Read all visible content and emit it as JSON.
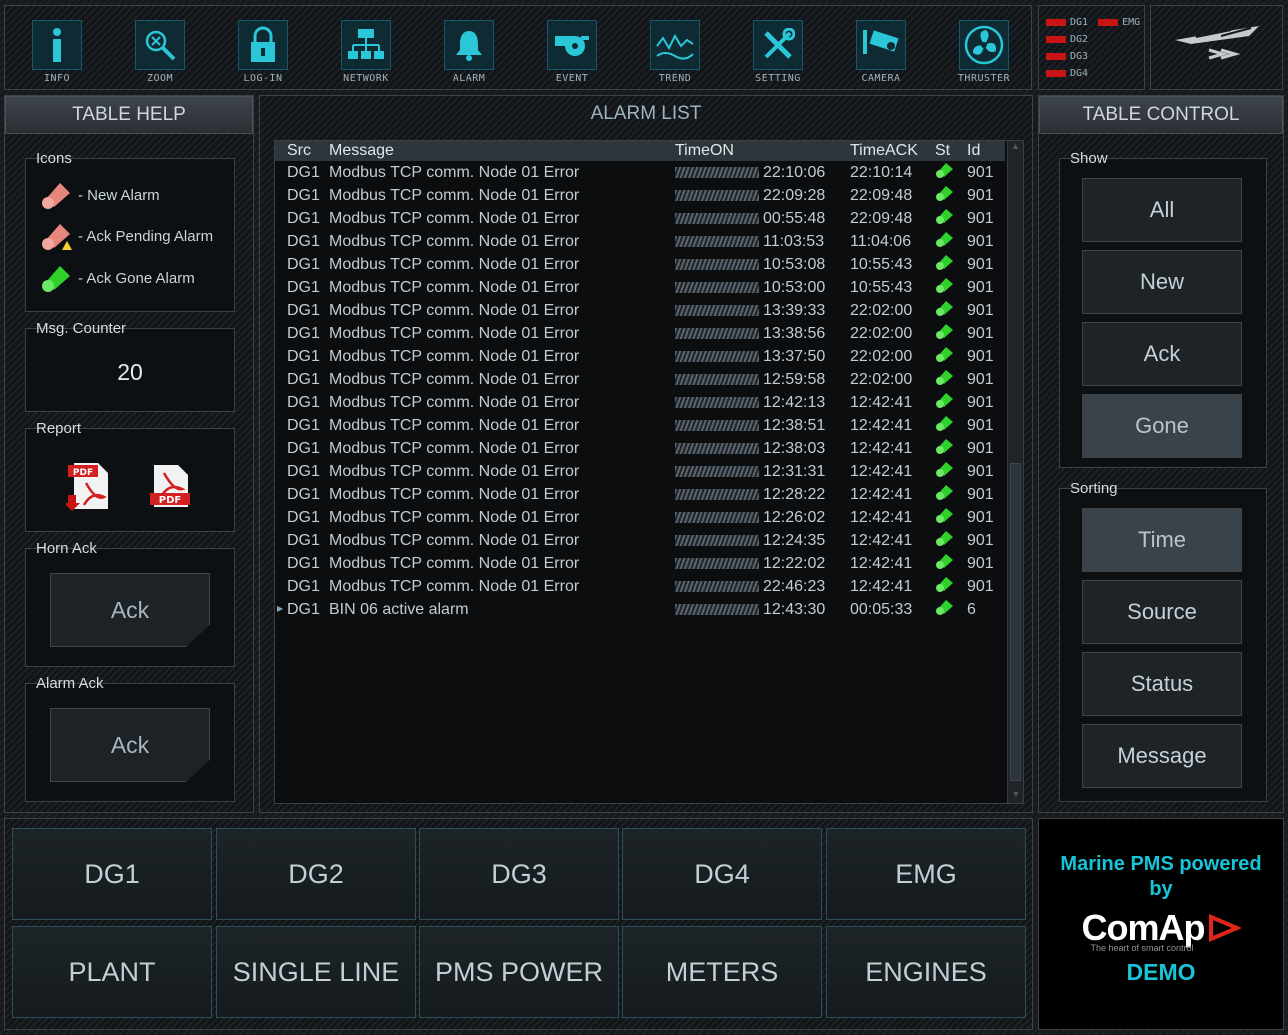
{
  "toolbar": [
    {
      "label": "INFO",
      "icon": "info-icon"
    },
    {
      "label": "ZOOM",
      "icon": "zoom-icon"
    },
    {
      "label": "LOG-IN",
      "icon": "lock-icon"
    },
    {
      "label": "NETWORK",
      "icon": "network-icon"
    },
    {
      "label": "ALARM",
      "icon": "bell-icon"
    },
    {
      "label": "EVENT",
      "icon": "whistle-icon"
    },
    {
      "label": "TREND",
      "icon": "trend-icon"
    },
    {
      "label": "SETTING",
      "icon": "tools-icon"
    },
    {
      "label": "CAMERA",
      "icon": "camera-icon"
    },
    {
      "label": "THRUSTER",
      "icon": "fan-icon"
    }
  ],
  "gen_status": {
    "a": "DG1",
    "b": "EMG",
    "c": "DG2",
    "d": "DG3",
    "e": "DG4"
  },
  "left": {
    "title": "TABLE HELP",
    "icons_title": "Icons",
    "new_alarm": "- New Alarm",
    "ack_pending": "- Ack Pending Alarm",
    "ack_gone": "- Ack Gone Alarm",
    "counter_title": "Msg. Counter",
    "counter_value": "20",
    "report_title": "Report",
    "horn_title": "Horn Ack",
    "horn_btn": "Ack",
    "alarm_title": "Alarm Ack",
    "alarm_btn": "Ack"
  },
  "center": {
    "title": "ALARM LIST",
    "columns": {
      "src": "Src",
      "msg": "Message",
      "on": "TimeON",
      "ack": "TimeACK",
      "st": "St",
      "id": "Id"
    },
    "rows": [
      {
        "src": "DG1",
        "msg": "Modbus TCP comm. Node 01  Error",
        "on": "22:10:06",
        "ack": "22:10:14",
        "id": "901"
      },
      {
        "src": "DG1",
        "msg": "Modbus TCP comm. Node 01  Error",
        "on": "22:09:28",
        "ack": "22:09:48",
        "id": "901"
      },
      {
        "src": "DG1",
        "msg": "Modbus TCP comm. Node 01  Error",
        "on": "00:55:48",
        "ack": "22:09:48",
        "id": "901"
      },
      {
        "src": "DG1",
        "msg": "Modbus TCP comm. Node 01  Error",
        "on": "11:03:53",
        "ack": "11:04:06",
        "id": "901"
      },
      {
        "src": "DG1",
        "msg": "Modbus TCP comm. Node 01  Error",
        "on": "10:53:08",
        "ack": "10:55:43",
        "id": "901"
      },
      {
        "src": "DG1",
        "msg": "Modbus TCP comm. Node 01  Error",
        "on": "10:53:00",
        "ack": "10:55:43",
        "id": "901"
      },
      {
        "src": "DG1",
        "msg": "Modbus TCP comm. Node 01  Error",
        "on": "13:39:33",
        "ack": "22:02:00",
        "id": "901"
      },
      {
        "src": "DG1",
        "msg": "Modbus TCP comm. Node 01  Error",
        "on": "13:38:56",
        "ack": "22:02:00",
        "id": "901"
      },
      {
        "src": "DG1",
        "msg": "Modbus TCP comm. Node 01  Error",
        "on": "13:37:50",
        "ack": "22:02:00",
        "id": "901"
      },
      {
        "src": "DG1",
        "msg": "Modbus TCP comm. Node 01  Error",
        "on": "12:59:58",
        "ack": "22:02:00",
        "id": "901"
      },
      {
        "src": "DG1",
        "msg": "Modbus TCP comm. Node 01  Error",
        "on": "12:42:13",
        "ack": "12:42:41",
        "id": "901"
      },
      {
        "src": "DG1",
        "msg": "Modbus TCP comm. Node 01  Error",
        "on": "12:38:51",
        "ack": "12:42:41",
        "id": "901"
      },
      {
        "src": "DG1",
        "msg": "Modbus TCP comm. Node 01  Error",
        "on": "12:38:03",
        "ack": "12:42:41",
        "id": "901"
      },
      {
        "src": "DG1",
        "msg": "Modbus TCP comm. Node 01  Error",
        "on": "12:31:31",
        "ack": "12:42:41",
        "id": "901"
      },
      {
        "src": "DG1",
        "msg": "Modbus TCP comm. Node 01  Error",
        "on": "12:28:22",
        "ack": "12:42:41",
        "id": "901"
      },
      {
        "src": "DG1",
        "msg": "Modbus TCP comm. Node 01  Error",
        "on": "12:26:02",
        "ack": "12:42:41",
        "id": "901"
      },
      {
        "src": "DG1",
        "msg": "Modbus TCP comm. Node 01  Error",
        "on": "12:24:35",
        "ack": "12:42:41",
        "id": "901"
      },
      {
        "src": "DG1",
        "msg": "Modbus TCP comm. Node 01  Error",
        "on": "12:22:02",
        "ack": "12:42:41",
        "id": "901"
      },
      {
        "src": "DG1",
        "msg": "Modbus TCP comm. Node 01  Error",
        "on": "22:46:23",
        "ack": "12:42:41",
        "id": "901"
      },
      {
        "src": "DG1",
        "msg": "BIN 06 active alarm",
        "on": "12:43:30",
        "ack": "00:05:33",
        "id": "6"
      }
    ]
  },
  "right": {
    "title": "TABLE CONTROL",
    "show_title": "Show",
    "show": [
      "All",
      "New",
      "Ack",
      "Gone"
    ],
    "sort_title": "Sorting",
    "sort": [
      "Time",
      "Source",
      "Status",
      "Message"
    ]
  },
  "nav": {
    "row1": [
      "DG1",
      "DG2",
      "DG3",
      "DG4",
      "EMG"
    ],
    "row2": [
      "PLANT",
      "SINGLE LINE",
      "PMS POWER",
      "METERS",
      "ENGINES"
    ]
  },
  "brand": {
    "line1": "Marine PMS powered",
    "line2": "by",
    "logo": "ComAp",
    "tagline": "The heart of smart control",
    "demo": "DEMO"
  },
  "colors": {
    "accent": "#17c4d8",
    "alarm_red": "#c91414",
    "ack_green": "#2fd12a"
  }
}
